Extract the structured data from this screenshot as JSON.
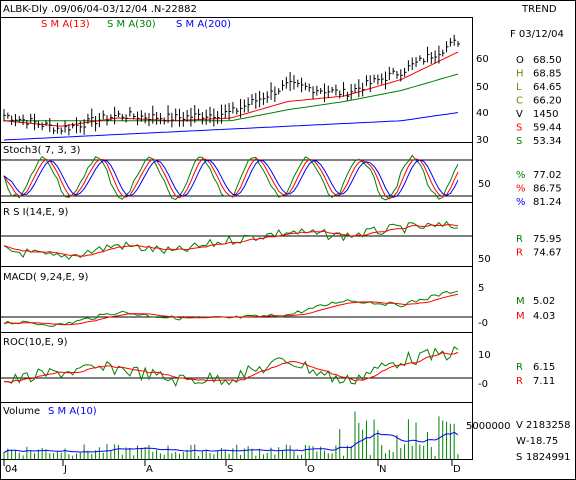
{
  "header": {
    "title": "ALBK-Dly .09/06/04-03/12/04 .N-22882",
    "mode": "TREND",
    "sma_labels": [
      {
        "text": "S M A(13)",
        "color": "#ff0000"
      },
      {
        "text": "S M A(30)",
        "color": "#008000"
      },
      {
        "text": "S M A(200)",
        "color": "#0000ff"
      }
    ]
  },
  "quote": {
    "date": "F 03/12/04",
    "rows": [
      {
        "key": "O",
        "value": "68.50",
        "key_color": "#000000",
        "value_color": "#000000"
      },
      {
        "key": "H",
        "value": "68.85",
        "key_color": "#808000",
        "value_color": "#000000"
      },
      {
        "key": "L",
        "value": "64.65",
        "key_color": "#808000",
        "value_color": "#000000"
      },
      {
        "key": "C",
        "value": "66.20",
        "key_color": "#808000",
        "value_color": "#000000"
      },
      {
        "key": "V",
        "value": "1450",
        "key_color": "#000000",
        "value_color": "#000000"
      },
      {
        "key": "S",
        "value": "59.44",
        "key_color": "#ff0000",
        "value_color": "#000000"
      },
      {
        "key": "S",
        "value": "53.34",
        "key_color": "#008000",
        "value_color": "#000000"
      }
    ]
  },
  "panels": {
    "stoch": {
      "label": "Stoch3( 7, 3, 3)",
      "axis_ticks": [
        "50"
      ],
      "readouts": [
        {
          "key": "%",
          "value": "77.02",
          "color": "#008000"
        },
        {
          "key": "%",
          "value": "86.75",
          "color": "#ff0000"
        },
        {
          "key": "%",
          "value": "81.24",
          "color": "#0000ff"
        }
      ]
    },
    "rsi": {
      "label": "R S I(14,E, 9)",
      "axis_ticks": [
        "50"
      ],
      "readouts": [
        {
          "key": "R",
          "value": "75.95",
          "color": "#008000"
        },
        {
          "key": "R",
          "value": "74.67",
          "color": "#ff0000"
        }
      ]
    },
    "macd": {
      "label": "MACD( 9,24,E, 9)",
      "axis_ticks": [
        "5",
        "-0"
      ],
      "readouts": [
        {
          "key": "M",
          "value": "5.02",
          "color": "#008000"
        },
        {
          "key": "M",
          "value": "4.03",
          "color": "#ff0000"
        }
      ]
    },
    "roc": {
      "label": "ROC(10,E, 9)",
      "axis_ticks": [
        "10",
        "-0"
      ],
      "readouts": [
        {
          "key": "R",
          "value": "6.15",
          "color": "#008000"
        },
        {
          "key": "R",
          "value": "7.11",
          "color": "#ff0000"
        }
      ]
    },
    "volume": {
      "label": "Volume",
      "sma_label": "S M A(10)",
      "axis_ticks": [
        "5000000"
      ],
      "readouts": [
        {
          "key": "V",
          "value": "2183258",
          "color": "#000000"
        },
        {
          "key": "W",
          "value": "-18.75",
          "color": "#000000"
        },
        {
          "key": "S",
          "value": "1824991",
          "color": "#000000"
        }
      ]
    }
  },
  "price_axis_ticks": [
    "60",
    "50",
    "40",
    "30"
  ],
  "x_axis_labels": [
    "04",
    "J",
    "A",
    "S",
    "O",
    "N",
    "D"
  ],
  "chart_data": {
    "type": "line",
    "title": "ALBK-Dly .09/06/04-03/12/04 .N-22882",
    "x": [
      "Jun-04",
      "Jul-04",
      "Aug-04",
      "Sep-04",
      "Oct-04",
      "Nov-04",
      "Dec-04"
    ],
    "price_range": [
      30,
      70
    ],
    "series": [
      {
        "name": "S M A(13)",
        "values": [
          37,
          35,
          38,
          37,
          38,
          44,
          46,
          52,
          62
        ]
      },
      {
        "name": "S M A(30)",
        "values": [
          37,
          37,
          37,
          37,
          37,
          41,
          44,
          48,
          54
        ]
      },
      {
        "name": "S M A(200)",
        "values": [
          30,
          31,
          32,
          33,
          34,
          35,
          36,
          37,
          40
        ]
      },
      {
        "name": "Price",
        "values": [
          39,
          34,
          39,
          38,
          40,
          50,
          47,
          55,
          66
        ]
      }
    ],
    "grid": false,
    "colors": {
      "price": "#000000",
      "sma13": "#ff0000",
      "sma30": "#008000",
      "sma200": "#0000ff"
    }
  }
}
